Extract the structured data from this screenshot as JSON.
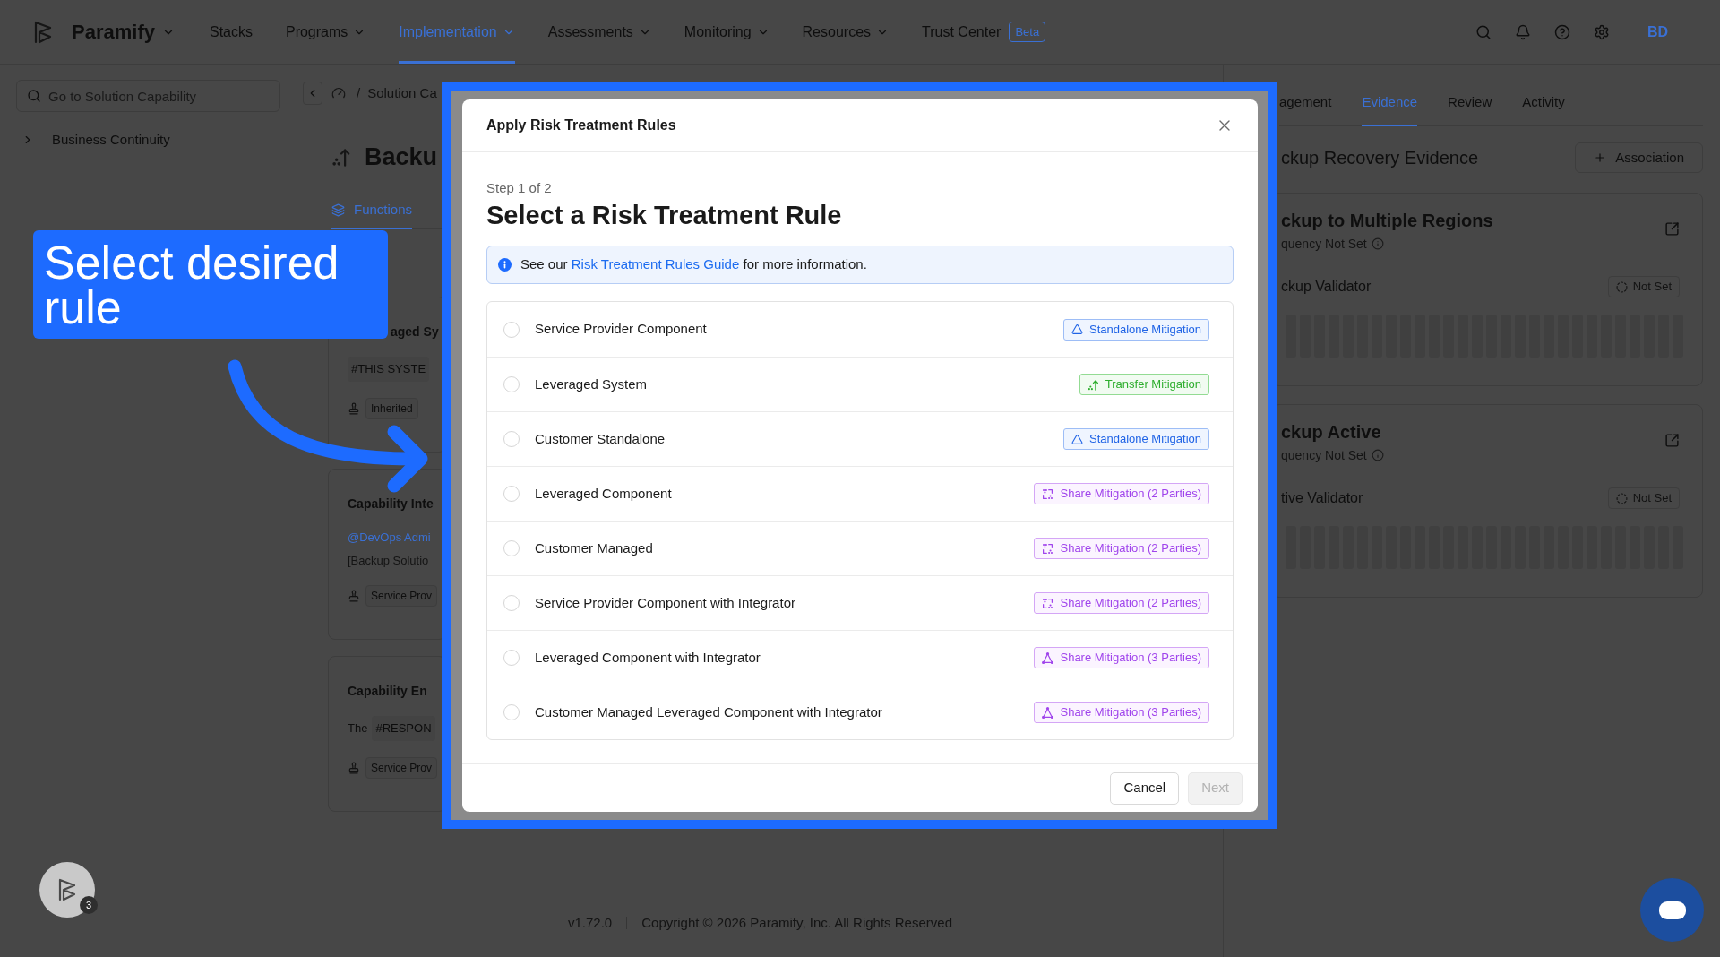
{
  "top_nav": {
    "brand": "Paramify",
    "items": [
      {
        "label": "Stacks",
        "dropdown": false,
        "selected": false
      },
      {
        "label": "Programs",
        "dropdown": true,
        "selected": false
      },
      {
        "label": "Implementation",
        "dropdown": true,
        "selected": true
      },
      {
        "label": "Assessments",
        "dropdown": true,
        "selected": false
      },
      {
        "label": "Monitoring",
        "dropdown": true,
        "selected": false
      },
      {
        "label": "Resources",
        "dropdown": true,
        "selected": false
      },
      {
        "label": "Trust Center",
        "dropdown": false,
        "selected": false,
        "badge": "Beta"
      }
    ],
    "avatar": "BD"
  },
  "sidebar": {
    "search_placeholder": "Go to Solution Capability",
    "items": [
      {
        "label": "Business Continuity",
        "expanded": false
      }
    ]
  },
  "main": {
    "breadcrumb": {
      "separator": "/",
      "items": [
        "Solution Ca"
      ]
    },
    "title": "Backu",
    "tabs": [
      {
        "label": "Functions",
        "selected": true
      }
    ],
    "cards": [
      {
        "title": "aged Sy",
        "body": [
          {
            "kind": "tag",
            "text": "#THIS SYSTE"
          }
        ],
        "chip": "Inherited"
      },
      {
        "title": "Capability Inte",
        "body": [
          {
            "kind": "mention",
            "text": "@DevOps Admi"
          },
          {
            "kind": "muted",
            "text": "[Backup Solutio"
          }
        ],
        "chip": "Service Prov"
      },
      {
        "title": "Capability En",
        "body": [
          {
            "kind": "text_tag",
            "text": "The",
            "tag": "#RESPON"
          }
        ],
        "chip": "Service Prov"
      }
    ]
  },
  "right_panel": {
    "tabs": [
      {
        "label": "agement",
        "selected": false
      },
      {
        "label": "Evidence",
        "selected": true
      },
      {
        "label": "Review",
        "selected": false
      },
      {
        "label": "Activity",
        "selected": false
      }
    ],
    "heading": "ckup Recovery Evidence",
    "add_button": "Association",
    "evidence": [
      {
        "title": "ckup to Multiple Regions",
        "frequency": "quency Not Set",
        "validator": "ckup Validator",
        "status": "Not Set"
      },
      {
        "title": "ckup Active",
        "frequency": "quency Not Set",
        "validator": "tive Validator",
        "status": "Not Set"
      }
    ]
  },
  "footer": {
    "version": "v1.72.0",
    "copyright": "Copyright © 2026 Paramify, Inc. All Rights Reserved"
  },
  "help_widget": {
    "badge": "3"
  },
  "annotation": {
    "callout": "Select desired rule"
  },
  "modal": {
    "title": "Apply Risk Treatment Rules",
    "step": "Step 1 of 2",
    "heading": "Select a Risk Treatment Rule",
    "info": {
      "before": "See our",
      "link": "Risk Treatment Rules Guide",
      "after": "for more information."
    },
    "rules": [
      {
        "label": "Service Provider Component",
        "selected": false,
        "treatment": {
          "kind": "standalone",
          "label": "Standalone Mitigation"
        }
      },
      {
        "label": "Leveraged System",
        "selected": false,
        "treatment": {
          "kind": "transfer",
          "label": "Transfer Mitigation"
        }
      },
      {
        "label": "Customer Standalone",
        "selected": false,
        "treatment": {
          "kind": "standalone",
          "label": "Standalone Mitigation"
        }
      },
      {
        "label": "Leveraged Component",
        "selected": false,
        "treatment": {
          "kind": "share_two",
          "label": "Share Mitigation (2 Parties)"
        }
      },
      {
        "label": "Customer Managed",
        "selected": false,
        "treatment": {
          "kind": "share_two",
          "label": "Share Mitigation (2 Parties)"
        }
      },
      {
        "label": "Service Provider Component with Integrator",
        "selected": false,
        "treatment": {
          "kind": "share_two",
          "label": "Share Mitigation (2 Parties)"
        }
      },
      {
        "label": "Leveraged Component with Integrator",
        "selected": false,
        "treatment": {
          "kind": "share_three",
          "label": "Share Mitigation (3 Parties)"
        }
      },
      {
        "label": "Customer Managed Leveraged Component with Integrator",
        "selected": false,
        "treatment": {
          "kind": "share_three",
          "label": "Share Mitigation (3 Parties)"
        }
      }
    ],
    "buttons": [
      {
        "label": "Cancel",
        "disabled": false
      },
      {
        "label": "Next",
        "disabled": true
      }
    ]
  }
}
